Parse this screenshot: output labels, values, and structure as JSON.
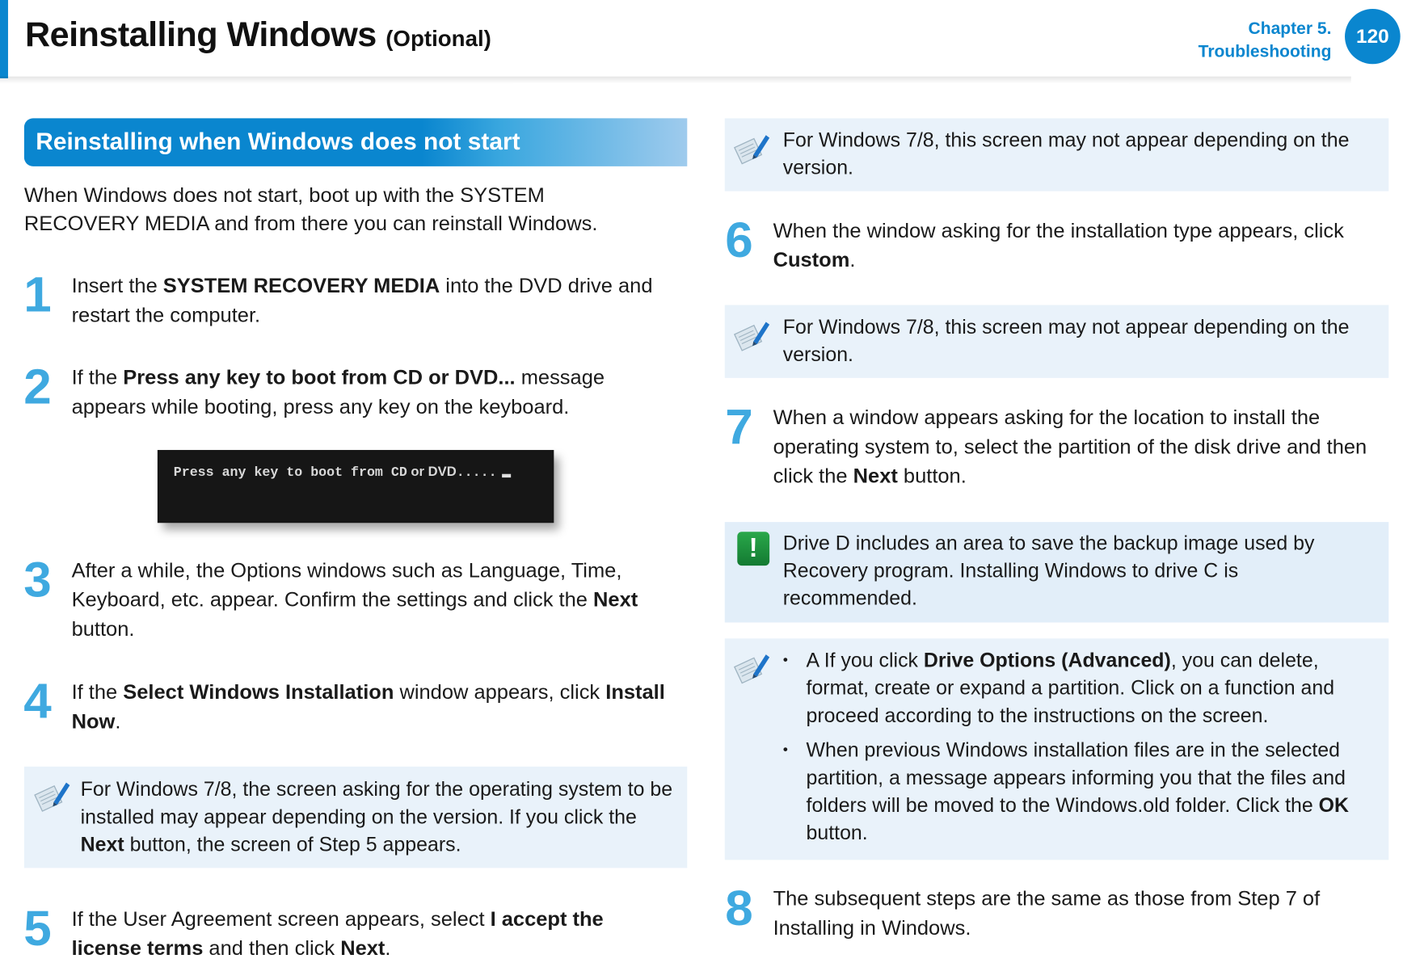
{
  "header": {
    "title": "Reinstalling Windows",
    "title_suffix": "(Optional)",
    "chapter_line1": "Chapter 5.",
    "chapter_line2": "Troubleshooting",
    "page_number": "120",
    "accent_color": "#0a86cf"
  },
  "section": {
    "title": "Reinstalling when Windows does not start",
    "intro": "When Windows does not start, boot up with the SYSTEM RECOVERY MEDIA and from there you can reinstall Windows."
  },
  "steps": [
    {
      "num": "1",
      "pre": "Insert the ",
      "bold": "SYSTEM RECOVERY MEDIA",
      "post": " into the DVD drive and restart the computer."
    },
    {
      "num": "2",
      "pre": "If the ",
      "bold": "Press any key to boot from CD or DVD...",
      "post": " message appears while booting, press any key on the keyboard."
    },
    {
      "num": "3",
      "pre": "After a while, the Options windows such as Language, Time, Keyboard, etc. appear. Confirm the settings and click the ",
      "bold": "Next",
      "post": " button."
    },
    {
      "num": "4",
      "pre": "If the ",
      "bold": "Select Windows Installation",
      "post": " window appears, click ",
      "bold2": "Install Now",
      "post2": "."
    },
    {
      "num": "5",
      "pre": "If the User Agreement screen appears, select ",
      "bold": "I accept the license terms",
      "post": " and then click ",
      "bold2": "Next",
      "post2": "."
    },
    {
      "num": "6",
      "pre": "When the window asking for the installation type appears, click ",
      "bold": "Custom",
      "post": "."
    },
    {
      "num": "7",
      "pre": "When a window appears asking for the location to install the operating system to, select the partition of the disk drive and then click the ",
      "bold": "Next",
      "post": " button."
    },
    {
      "num": "8",
      "pre": "The subsequent steps are the same as those from Step 7 of Installing in Windows.",
      "bold": "",
      "post": ""
    }
  ],
  "boot_screen": {
    "text_mono": "Press any key to boot from CD",
    "text_sans": " or DVD",
    "dots": "....."
  },
  "notes": {
    "step4_note": {
      "pre": "For Windows 7/8, the screen asking for the operating system to be installed may appear depending on the version. If you click the ",
      "bold": "Next",
      "post": " button, the screen of Step 5 appears."
    },
    "step5_note": "For Windows 7/8, this screen may not appear depending on the version.",
    "step6_note": "For Windows 7/8, this screen may not appear depending on the version.",
    "warning": "Drive D includes an area to save the backup image used by Recovery program. Installing Windows to drive C is recommended.",
    "step7_bullets": [
      {
        "pre": "A If you click ",
        "bold": "Drive Options (Advanced)",
        "post": ", you can delete, format, create or expand a partition. Click on a function and proceed according to the instructions on the screen."
      },
      {
        "pre": "When previous Windows installation files are in the selected partition, a message appears informing you that the files and folders will be moved to the Windows.old folder. Click the ",
        "bold": "OK",
        "post": " button."
      }
    ]
  },
  "icons": {
    "note": "pencil-note-icon",
    "warning": "exclamation-warning-icon"
  }
}
